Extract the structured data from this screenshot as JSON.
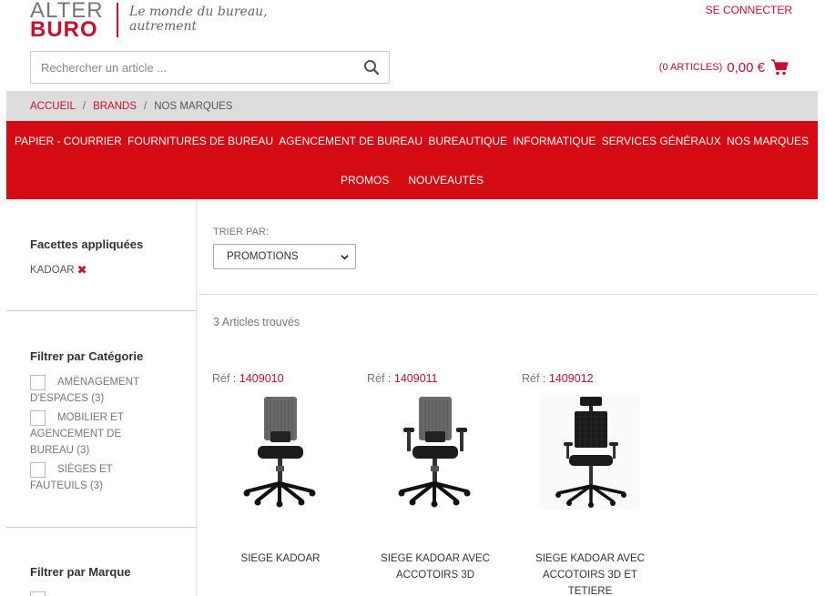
{
  "header": {
    "logo_line1": "ALTER",
    "logo_line2": "BURO",
    "tagline_line1": "Le monde du bureau,",
    "tagline_line2": "autrement",
    "login_label": "SE CONNECTER",
    "search_placeholder": "Rechercher un article ...",
    "cart_count": "(0 ARTICLES)",
    "cart_total": "0,00 €"
  },
  "breadcrumb": [
    {
      "label": "ACCUEIL"
    },
    {
      "label": "BRANDS"
    },
    {
      "label": "NOS MARQUES"
    }
  ],
  "nav": {
    "row1": [
      "PAPIER - COURRIER",
      "FOURNITURES DE BUREAU",
      "AGENCEMENT DE BUREAU",
      "BUREAUTIQUE",
      "INFORMATIQUE",
      "SERVICES GÉNÉRAUX",
      "NOS MARQUES"
    ],
    "row2": [
      "PROMOS",
      "NOUVEAUTÉS"
    ]
  },
  "sidebar": {
    "applied_title": "Facettes appliquées",
    "applied_facet": "KADOAR",
    "category_title": "Filtrer par Catégorie",
    "categories": [
      {
        "label": "AMÉNAGEMENT D'ESPACES",
        "count": "(3)"
      },
      {
        "label": "MOBILIER ET AGENCEMENT DE BUREAU",
        "count": "(3)"
      },
      {
        "label": "SIÈGES ET FAUTEUILS",
        "count": "(3)"
      }
    ],
    "brand_title": "Filtrer par Marque"
  },
  "main": {
    "sort_label": "TRIER PAR:",
    "sort_value": "PROMOTIONS",
    "results_count": "3 Articles trouvés"
  },
  "products": [
    {
      "ref_label": "Réf :",
      "ref": "1409010",
      "name_line1": "SIEGE KADOAR",
      "name_line2": "",
      "name_line3": ""
    },
    {
      "ref_label": "Réf :",
      "ref": "1409011",
      "name_line1": "SIEGE KADOAR AVEC",
      "name_line2": "ACCOTOIRS 3D",
      "name_line3": ""
    },
    {
      "ref_label": "Réf :",
      "ref": "1409012",
      "name_line1": "SIEGE KADOAR AVEC",
      "name_line2": "ACCOTOIRS 3D ET",
      "name_line3": "TETIERE"
    }
  ],
  "colors": {
    "brand_red": "#d50b14",
    "link_red": "#c8102e",
    "breadcrumb_bg": "#dddddd"
  }
}
